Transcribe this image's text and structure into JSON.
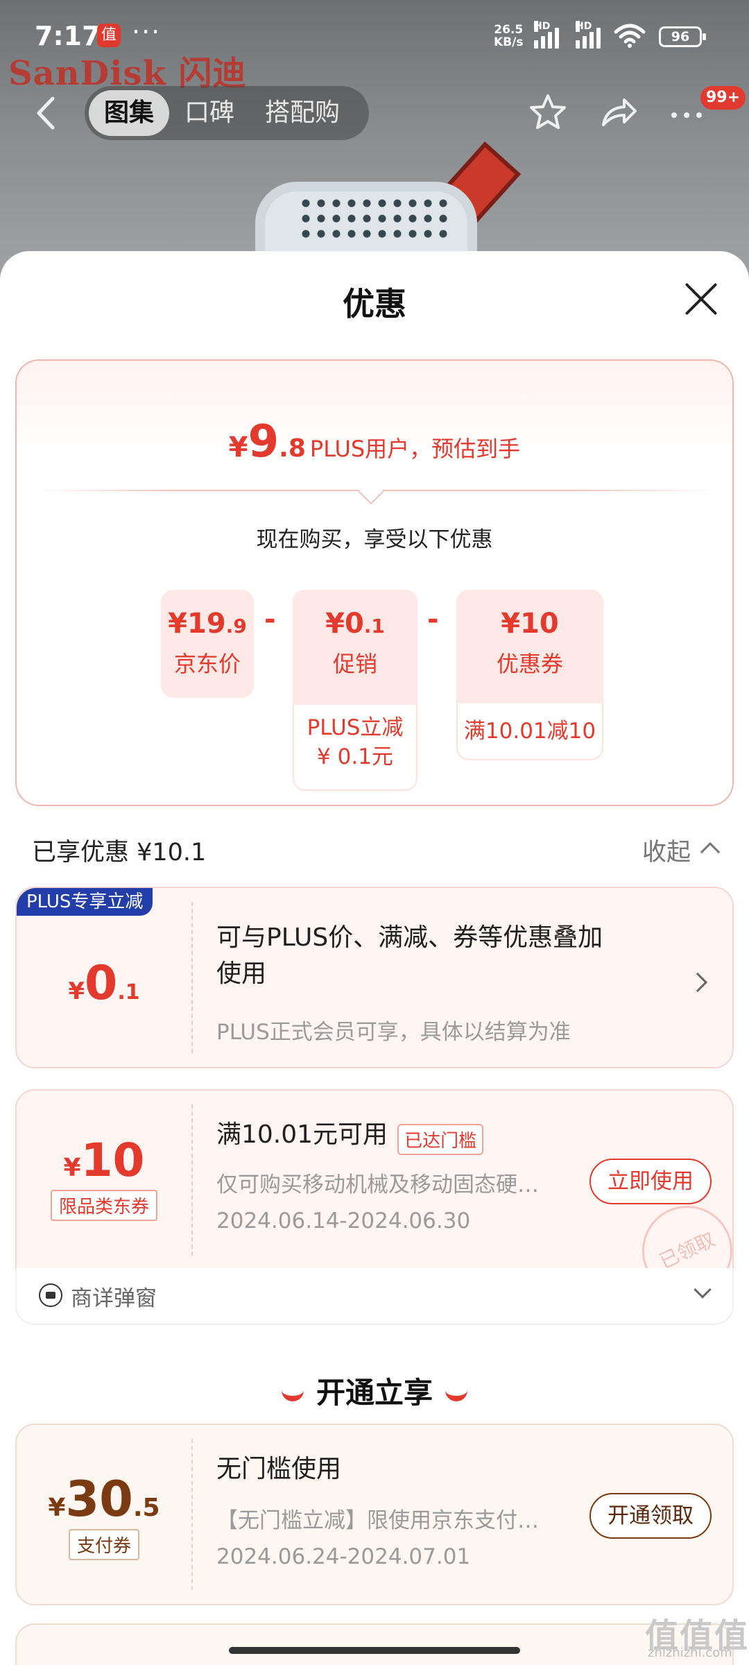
{
  "status_bar": {
    "time": "7:17",
    "app_icon_char": "值",
    "dots": "···",
    "speed_top": "26.5",
    "speed_unit": "KB/s",
    "hd1": "HD",
    "hd2": "HD",
    "battery": "96"
  },
  "background": {
    "brand": "SanDisk 闪迪",
    "tabs": [
      "图集",
      "口碑",
      "搭配购"
    ],
    "active_tab": "图集",
    "cart_badge": "99+"
  },
  "sheet": {
    "title": "优惠",
    "estimate": {
      "yen": "¥",
      "integer": "9",
      "decimal": ".8",
      "text": "PLUS用户，预估到手"
    },
    "buy_now_text": "现在购买，享受以下优惠",
    "calc": [
      {
        "yen": "¥",
        "amount": "19",
        "decimal": ".9",
        "label": "京东价",
        "sub": ""
      },
      {
        "yen": "¥",
        "amount": "0",
        "decimal": ".1",
        "label": "促销",
        "sub": "PLUS立减\n¥ 0.1元"
      },
      {
        "yen": "¥",
        "amount": "10",
        "decimal": "",
        "label": "优惠券",
        "sub": "满10.01减10"
      }
    ],
    "minus_sign": "-",
    "enjoyed_text": "已享优惠 ¥10.1",
    "collapse_text": "收起",
    "coupon_plus": {
      "tag": "PLUS专享立减",
      "yen": "¥",
      "integer": "0",
      "decimal": ".1",
      "title": "可与PLUS价、满减、券等优惠叠加使用",
      "desc": "PLUS正式会员可享，具体以结算为准"
    },
    "coupon_jd": {
      "yen": "¥",
      "amount": "10",
      "type_tag": "限品类东券",
      "title": "满10.01元可用",
      "threshold_tag": "已达门槛",
      "desc": "仅可购买移动机械及移动固态硬…",
      "dates": "2024.06.14-2024.06.30",
      "button": "立即使用",
      "stamp": "已领取"
    },
    "popup_text": "商详弹窗",
    "open_header": "开通立享",
    "coupon_pay": {
      "yen": "¥",
      "integer": "30",
      "decimal": ".5",
      "type_tag": "支付券",
      "title": "无门槛使用",
      "desc": "【无门槛立减】限使用京东支付…",
      "dates": "2024.06.24-2024.07.01",
      "button": "开通领取"
    }
  },
  "watermark": {
    "main": "值值值",
    "sub": "zhizhizhi.com"
  }
}
